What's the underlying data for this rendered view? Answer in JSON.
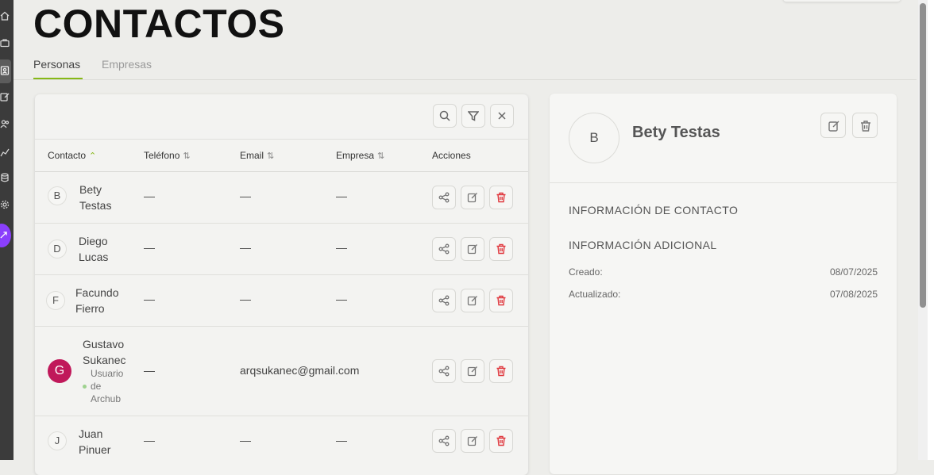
{
  "header": {
    "title": "CONTACTOS"
  },
  "tabs": [
    {
      "label": "Personas",
      "active": true
    },
    {
      "label": "Empresas",
      "active": false
    }
  ],
  "toolbar": {
    "icons": [
      "search-icon",
      "filter-icon",
      "close-icon"
    ]
  },
  "table": {
    "columns": {
      "contact": "Contacto",
      "phone": "Teléfono",
      "email": "Email",
      "company": "Empresa",
      "actions": "Acciones"
    },
    "sort_glyph_active": "⌃",
    "sort_glyph": "⇅",
    "rows": [
      {
        "initial": "B",
        "name_1": "Bety",
        "name_2": "Testas",
        "phone": "—",
        "email": "—",
        "company": "—"
      },
      {
        "initial": "D",
        "name_1": "Diego",
        "name_2": "Lucas",
        "phone": "—",
        "email": "—",
        "company": "—"
      },
      {
        "initial": "F",
        "name_1": "Facundo",
        "name_2": "Fierro",
        "phone": "—",
        "email": "—",
        "company": "—"
      },
      {
        "initial": "G",
        "name_1": "Gustavo",
        "name_2": "Sukanec",
        "badge_1": "Usuario",
        "badge_2": "de",
        "badge_3": "Archub",
        "phone": "—",
        "email": "arqsukanec@gmail.com",
        "company": ""
      },
      {
        "initial": "J",
        "name_1": "Juan",
        "name_2": "Pinuer",
        "phone": "—",
        "email": "—",
        "company": "—"
      }
    ],
    "row_actions": [
      "share-icon",
      "edit-icon",
      "delete-icon"
    ]
  },
  "detail": {
    "initial": "B",
    "name": "Bety Testas",
    "section_contact": "INFORMACIÓN DE CONTACTO",
    "section_additional": "INFORMACIÓN ADICIONAL",
    "created_label": "Creado:",
    "created_value": "08/07/2025",
    "updated_label": "Actualizado:",
    "updated_value": "07/08/2025"
  },
  "colors": {
    "accent": "#86b817",
    "danger": "#e0383e",
    "avatar_user": "#c0185a",
    "rail": "#3b3b3b",
    "rail_bubble": "#8a3ffc"
  }
}
